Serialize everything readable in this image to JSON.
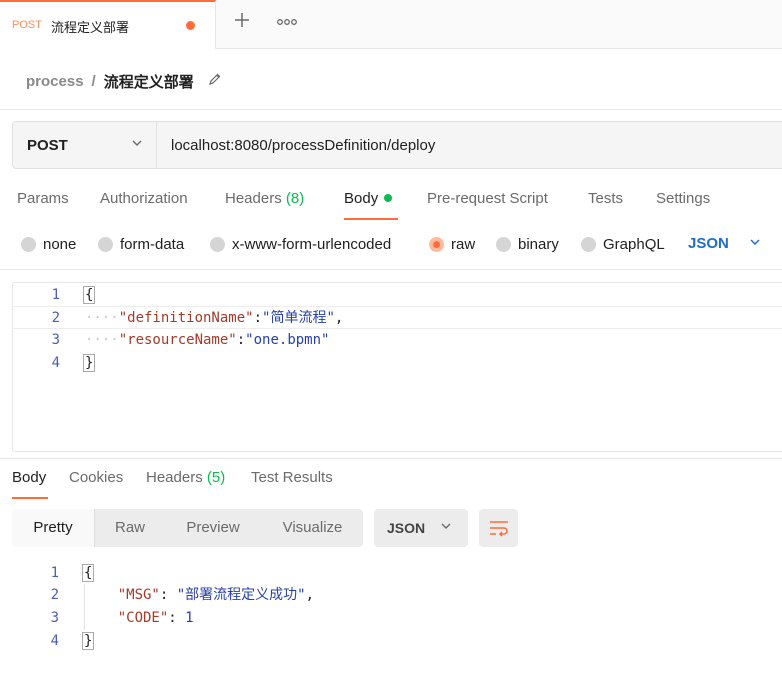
{
  "tab": {
    "method": "POST",
    "title": "流程定义部署",
    "add_icon": "plus-icon",
    "more_icon": "ellipsis-icon"
  },
  "breadcrumb": {
    "parent": "process",
    "separator": "/",
    "current": "流程定义部署",
    "edit_icon": "pencil-icon"
  },
  "request": {
    "method": "POST",
    "url": "localhost:8080/processDefinition/deploy"
  },
  "request_tabs": [
    {
      "label": "Params"
    },
    {
      "label": "Authorization"
    },
    {
      "label": "Headers",
      "count": "(8)"
    },
    {
      "label": "Body"
    },
    {
      "label": "Pre-request Script"
    },
    {
      "label": "Tests"
    },
    {
      "label": "Settings"
    }
  ],
  "body_types": [
    {
      "label": "none"
    },
    {
      "label": "form-data"
    },
    {
      "label": "x-www-form-urlencoded"
    },
    {
      "label": "raw",
      "selected": true
    },
    {
      "label": "binary"
    },
    {
      "label": "GraphQL"
    }
  ],
  "body_language": "JSON",
  "request_body": {
    "line_numbers": [
      "1",
      "2",
      "3",
      "4"
    ],
    "open_brace": "{",
    "close_brace": "}",
    "key1": "\"definitionName\"",
    "value1": "\"简单流程\"",
    "key2": "\"resourceName\"",
    "value2": "\"one.bpmn\""
  },
  "response_tabs": [
    {
      "label": "Body"
    },
    {
      "label": "Cookies"
    },
    {
      "label": "Headers",
      "count": "(5)"
    },
    {
      "label": "Test Results"
    }
  ],
  "view_modes": [
    "Pretty",
    "Raw",
    "Preview",
    "Visualize"
  ],
  "response_format": "JSON",
  "response_body": {
    "line_numbers": [
      "1",
      "2",
      "3",
      "4"
    ],
    "open_brace": "{",
    "close_brace": "}",
    "key1": "\"MSG\"",
    "value1": "\"部署流程定义成功\"",
    "key2": "\"CODE\"",
    "value2": "1"
  },
  "colors": {
    "accent": "#ff6c37",
    "success": "#0cbb52",
    "link": "#1d6ecd"
  }
}
